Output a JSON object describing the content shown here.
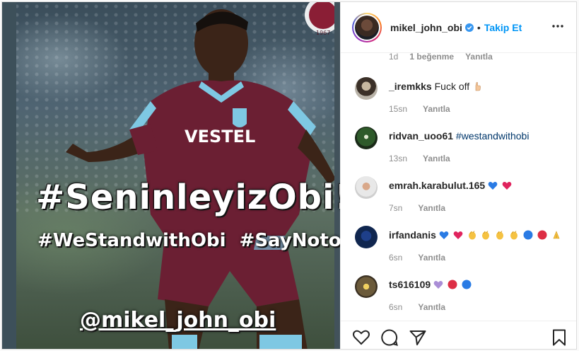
{
  "post": {
    "image": {
      "headline": "#SeninleyizObi!",
      "hashtags": "#WeStandwithObi  #SayNotoRacism",
      "handle": "@mikel_john_obi",
      "jersey_sponsor": "VESTEL",
      "club_year": "1967"
    },
    "header": {
      "username": "mikel_john_obi",
      "follow_label": "Takip Et",
      "separator": "•"
    },
    "previous_comment_meta": {
      "time": "1d",
      "likes": "1 beğenme",
      "reply": "Yanıtla"
    },
    "comments": [
      {
        "user": "_iremkks",
        "text": "Fuck off",
        "emoji": [
          "hand-icon"
        ],
        "time": "15sn",
        "reply": "Yanıtla"
      },
      {
        "user": "ridvan_uoo61",
        "text": "",
        "tag": "#westandwithobi",
        "time": "13sn",
        "reply": "Yanıtla"
      },
      {
        "user": "emrah.karabulut.165",
        "text": "",
        "emoji": [
          "blue-heart-icon",
          "red-heart-icon"
        ],
        "time": "7sn",
        "reply": "Yanıtla"
      },
      {
        "user": "irfandanis",
        "text": "",
        "emoji": [
          "blue-heart-icon",
          "red-heart-icon",
          "clap-icon",
          "clap-icon",
          "clap-icon",
          "clap-icon",
          "blue-circle-icon",
          "red-circle-icon",
          "pray-icon"
        ],
        "time": "6sn",
        "reply": "Yanıtla"
      },
      {
        "user": "ts616109",
        "text": "",
        "emoji": [
          "purple-heart-icon",
          "red-circle-icon",
          "blue-circle-icon"
        ],
        "time": "6sn",
        "reply": "Yanıtla"
      }
    ],
    "colors": {
      "link_blue": "#0095f6",
      "tag_blue": "#00376b",
      "muted": "#8e8e8e",
      "text": "#262626",
      "maroon": "#6b1f33",
      "sky_blue": "#7ec8e3"
    }
  }
}
